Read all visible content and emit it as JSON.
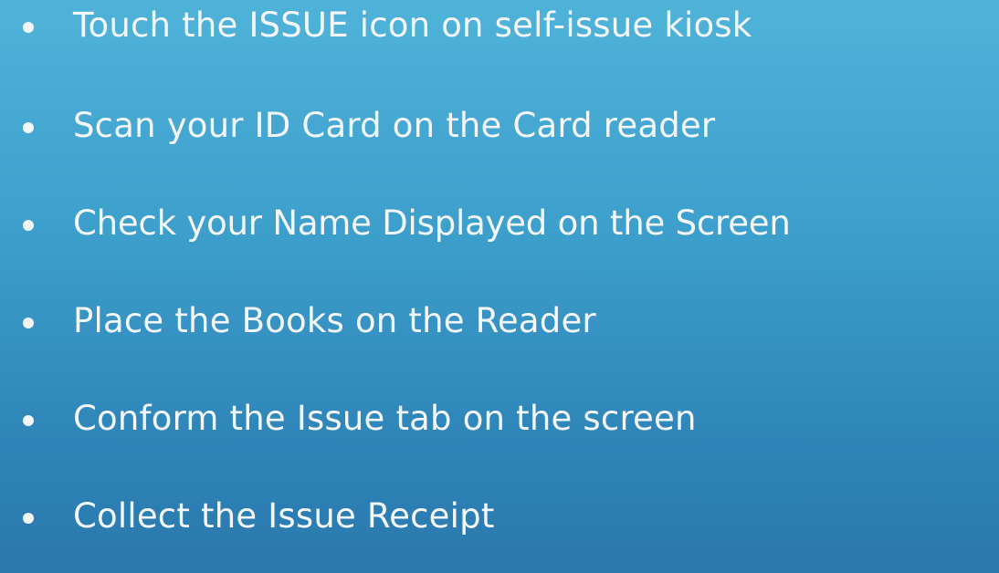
{
  "steps": [
    {
      "text": "Touch the ISSUE icon on self-issue kiosk"
    },
    {
      "text": "Scan your ID Card on the Card reader"
    },
    {
      "text": "Check your Name Displayed on the Screen"
    },
    {
      "text": "Place the Books on the Reader"
    },
    {
      "text": "Conform the Issue tab on the screen"
    },
    {
      "text": "Collect the Issue Receipt"
    }
  ],
  "colors": {
    "background_top": "#4fb3d9",
    "background_bottom": "#2a78ad",
    "text": "#f4f7fa"
  }
}
